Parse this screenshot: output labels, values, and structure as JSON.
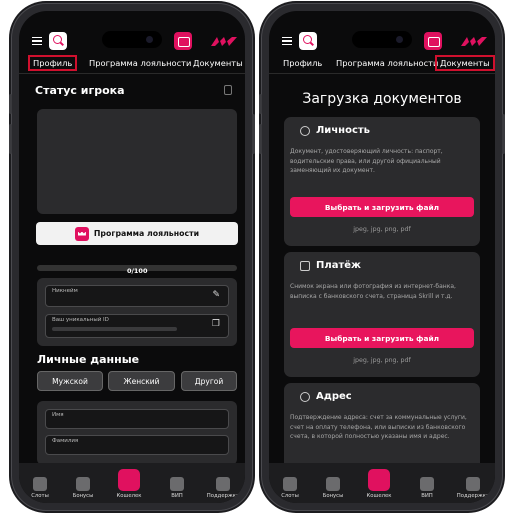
{
  "left": {
    "tabs": [
      "Профиль",
      "Программа лояльности",
      "Документы"
    ],
    "player_status_title": "Статус игрока",
    "loyalty_button": "Программа лояльности",
    "progress": {
      "label": "0/100",
      "value": 0
    },
    "nickname_label": "Никнейм",
    "id_label": "Ваш уникальный ID",
    "personal_data_title": "Личные данные",
    "genders": [
      "Мужской",
      "Женский",
      "Другой"
    ],
    "name_label": "Имя",
    "surname_label": "Фамилия"
  },
  "right": {
    "tabs": [
      "Профиль",
      "Программа лояльности",
      "Документы"
    ],
    "title": "Загрузка документов",
    "sections": [
      {
        "title": "Личность",
        "icon": "person-circle-icon",
        "description": "Документ, удостоверяющий                      личность: паспорт, водительские права, или другой официальный заменяющий их документ.",
        "button": "Выбрать и загрузить файл",
        "formats": "jpeg, jpg, png, pdf"
      },
      {
        "title": "Платёж",
        "icon": "payment-icon",
        "description": "Снимок экрана или фотография из интернет-банка, выписка с банковского счета, страница Skrill и т.д.",
        "button": "Выбрать и загрузить файл",
        "formats": "jpeg, jpg, png, pdf"
      },
      {
        "title": "Адрес",
        "icon": "address-icon",
        "description": "Подтверждение               адреса: счет за коммунальные услуги, счет на оплату телефона, или выписки из банковского счета, в которой полностью указаны               имя и адрес."
      }
    ]
  },
  "bottom_nav": [
    "Слоты",
    "Бонусы",
    "Кошелек",
    "ВИП",
    "Поддержка"
  ],
  "colors": {
    "accent": "#e0115f",
    "highlight_box": "#d0102e",
    "background": "#0b0b0c"
  }
}
